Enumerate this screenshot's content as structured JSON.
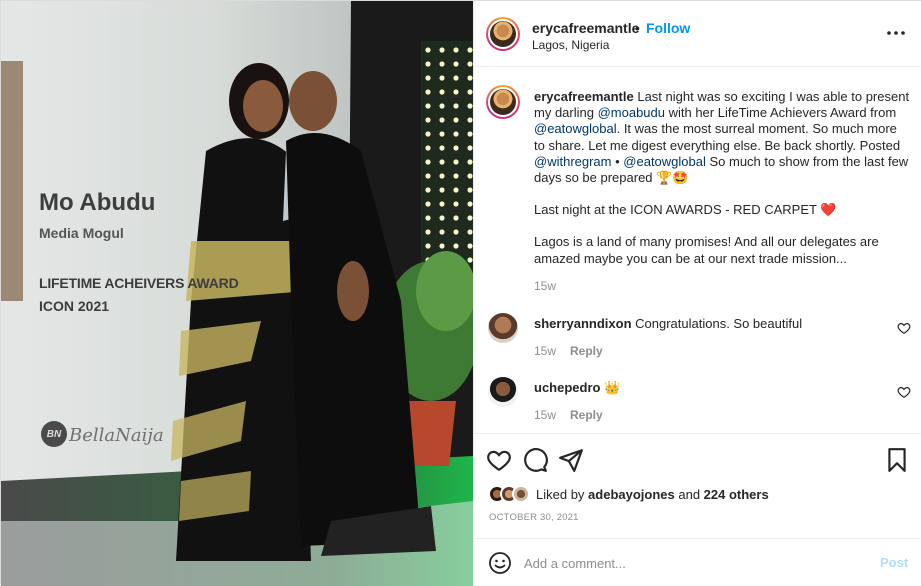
{
  "colors": {
    "link": "#0095f6",
    "mention": "#00376b",
    "muted": "#8e8e8e",
    "heart": "#ed4956"
  },
  "photo": {
    "banner_name": "Mo Abudu",
    "banner_role": "Media Mogul",
    "banner_award": "LIFETIME ACHEIVERS AWARD",
    "banner_year": "ICON 2021",
    "logo_badge": "BN",
    "logo_text": "BellaNaija"
  },
  "header": {
    "username": "erycafreemantle",
    "separator": "•",
    "follow_label": "Follow",
    "location": "Lagos, Nigeria",
    "more_icon": "more-horizontal-icon"
  },
  "caption": {
    "username": "erycafreemantle",
    "text1": " Last night was so exciting I was able to present my darling ",
    "mention1": "@moabudu",
    "text2": " with her LifeTime Achievers Award from ",
    "mention2": "@eatowglobal",
    "text3": ". It was the most surreal moment. So much more to share. Let me digest everything else. Be back shortly. Posted ",
    "mention3": "@withregram",
    "text4": " • ",
    "mention4": "@eatowglobal",
    "text5": " So much to show from the last few days so be prepared 🏆🤩",
    "para2": "Last night at the ICON AWARDS - RED CARPET ❤️",
    "para3": "Lagos is a land of many promises! And all our delegates are amazed maybe you can be at our next trade mission...",
    "age": "15w"
  },
  "comments": [
    {
      "username": "sherryanndixon",
      "text": " Congratulations. So beautiful",
      "age": "15w",
      "reply_label": "Reply"
    },
    {
      "username": "uchepedro",
      "text": " 👑",
      "age": "15w",
      "reply_label": "Reply"
    }
  ],
  "likes": {
    "prefix": "Liked by ",
    "user": "adebayojones",
    "middle": " and ",
    "count": "224 others"
  },
  "date": "OCTOBER 30, 2021",
  "add_comment": {
    "placeholder": "Add a comment...",
    "post_label": "Post"
  }
}
